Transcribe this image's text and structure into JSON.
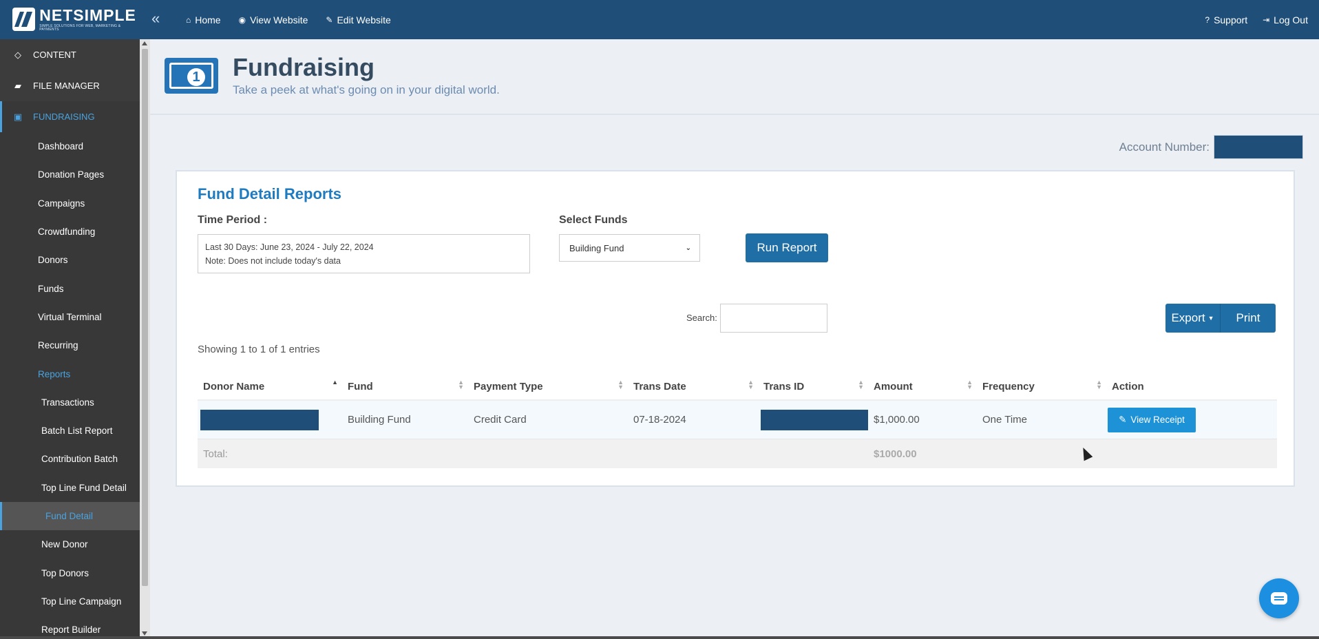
{
  "brand": {
    "name": "NETSIMPLE",
    "tagline": "SIMPLE SOLUTIONS FOR WEB, MARKETING & PAYMENTS"
  },
  "topnav": {
    "items": [
      {
        "icon": "home-icon",
        "label": "Home"
      },
      {
        "icon": "eye-icon",
        "label": "View Website"
      },
      {
        "icon": "edit-icon",
        "label": "Edit Website"
      }
    ],
    "support": "Support",
    "logout": "Log Out"
  },
  "sidebar": {
    "sections": [
      {
        "icon": "diamond-icon",
        "label": "CONTENT"
      },
      {
        "icon": "folder-icon",
        "label": "FILE MANAGER"
      },
      {
        "icon": "money-icon",
        "label": "FUNDRAISING"
      }
    ],
    "fundraising_items": [
      "Dashboard",
      "Donation Pages",
      "Campaigns",
      "Crowdfunding",
      "Donors",
      "Funds",
      "Virtual Terminal",
      "Recurring",
      "Reports"
    ],
    "report_items": [
      "Transactions",
      "Batch List Report",
      "Contribution Batch",
      "Top Line Fund Detail",
      "Fund Detail",
      "New Donor",
      "Top Donors",
      "Top Line Campaign",
      "Report Builder"
    ]
  },
  "page": {
    "title": "Fundraising",
    "subtitle": "Take a peek at what's going on in your digital world.",
    "account_label": "Account Number:"
  },
  "report": {
    "title": "Fund Detail Reports",
    "time_period_label": "Time Period :",
    "period_line1": "Last 30 Days: June 23, 2024 - July 22, 2024",
    "period_line2": "Note: Does not include today's data",
    "select_funds_label": "Select Funds",
    "selected_fund": "Building Fund",
    "run_button": "Run Report",
    "search_label": "Search:",
    "search_value": "",
    "export_button": "Export",
    "print_button": "Print",
    "showing": "Showing 1 to 1 of 1 entries"
  },
  "table": {
    "headers": [
      "Donor Name",
      "Fund",
      "Payment Type",
      "Trans Date",
      "Trans ID",
      "Amount",
      "Frequency",
      "Action"
    ],
    "rows": [
      {
        "fund": "Building Fund",
        "payment_type": "Credit Card",
        "trans_date": "07-18-2024",
        "amount": "$1,000.00",
        "frequency": "One Time",
        "action": "View Receipt"
      }
    ],
    "total_label": "Total:",
    "total_amount": "$1000.00"
  },
  "colors": {
    "topbar": "#1f4e79",
    "sidebar": "#3c3c3c",
    "accent": "#4aa3df",
    "button": "#1f6ea6",
    "receipt_button": "#1d92d6"
  }
}
